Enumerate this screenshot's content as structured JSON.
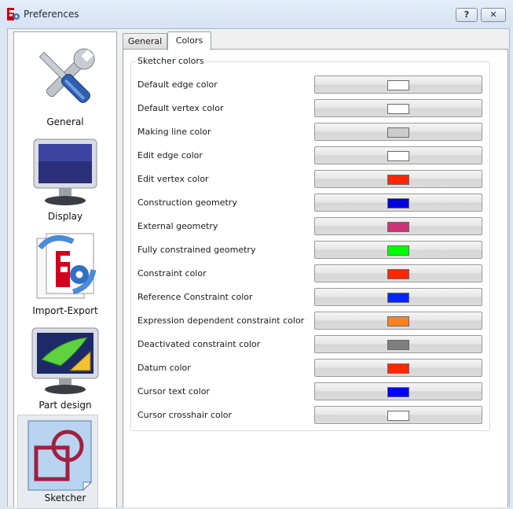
{
  "window": {
    "title": "Preferences",
    "help_label": "?",
    "close_label": "✕"
  },
  "sidebar": {
    "items": [
      {
        "label": "General",
        "icon": "wrench-screwdriver-icon"
      },
      {
        "label": "Display",
        "icon": "monitor-icon"
      },
      {
        "label": "Import-Export",
        "icon": "import-export-icon"
      },
      {
        "label": "Part design",
        "icon": "part-design-icon"
      },
      {
        "label": "Sketcher",
        "icon": "sketcher-icon",
        "selected": true
      }
    ]
  },
  "tabs": [
    {
      "label": "General",
      "active": false
    },
    {
      "label": "Colors",
      "active": true
    }
  ],
  "group": {
    "title": "Sketcher colors",
    "rows": [
      {
        "label": "Default edge color",
        "color": "#ffffff"
      },
      {
        "label": "Default vertex color",
        "color": "#ffffff"
      },
      {
        "label": "Making line color",
        "color": "#cccccc"
      },
      {
        "label": "Edit edge color",
        "color": "#ffffff"
      },
      {
        "label": "Edit vertex color",
        "color": "#ff2600"
      },
      {
        "label": "Construction geometry",
        "color": "#0000e0"
      },
      {
        "label": "External geometry",
        "color": "#cc3377"
      },
      {
        "label": "Fully constrained geometry",
        "color": "#00ff00"
      },
      {
        "label": "Constraint color",
        "color": "#ff2600"
      },
      {
        "label": "Reference Constraint color",
        "color": "#0026ff"
      },
      {
        "label": "Expression dependent constraint color",
        "color": "#ff8020"
      },
      {
        "label": "Deactivated constraint color",
        "color": "#7f7f7f"
      },
      {
        "label": "Datum color",
        "color": "#ff2600"
      },
      {
        "label": "Cursor text color",
        "color": "#0000ff"
      },
      {
        "label": "Cursor crosshair color",
        "color": "#ffffff"
      }
    ]
  }
}
